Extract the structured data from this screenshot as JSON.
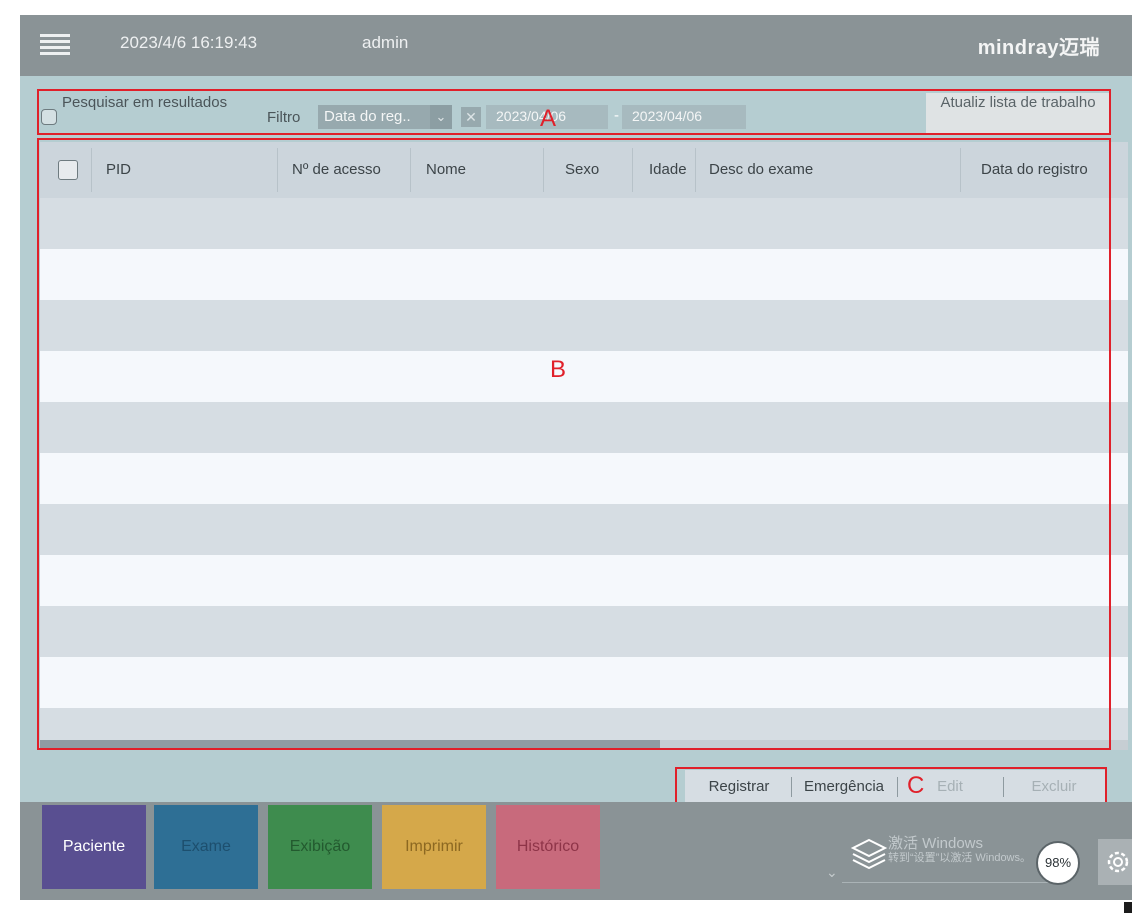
{
  "header": {
    "datetime": "2023/4/6 16:19:43",
    "user": "admin",
    "brand": "mindray迈瑞"
  },
  "filters": {
    "search_in_results_label": "Pesquisar em resultados",
    "filter_label": "Filtro",
    "filter_field": "Data do reg..",
    "date_from": "2023/04/06",
    "date_separator": "-",
    "date_to": "2023/04/06",
    "refresh_label": "Atualiz lista de trabalho"
  },
  "table": {
    "columns": [
      "PID",
      "Nº de acesso",
      "Nome",
      "Sexo",
      "Idade",
      "Desc do exame",
      "Data do registro"
    ],
    "rows": []
  },
  "actions": [
    {
      "label": "Registrar",
      "enabled": true
    },
    {
      "label": "Emergência",
      "enabled": true
    },
    {
      "label": "Edit",
      "enabled": false
    },
    {
      "label": "Excluir",
      "enabled": false
    }
  ],
  "nav": {
    "paciente": "Paciente",
    "exame": "Exame",
    "exibicao": "Exibição",
    "imprimir": "Imprimir",
    "historico": "Histórico"
  },
  "status": {
    "battery": "98%",
    "watermark_title": "激活 Windows",
    "watermark_sub": "转到“设置”以激活 Windows。"
  },
  "annotations": {
    "a": "A",
    "b": "B",
    "c": "C"
  },
  "colors": {
    "topbar": "#8a9396",
    "main_bg": "#b5cdd1",
    "annotation_red": "#e0202a",
    "tab_paciente": "#594f91",
    "tab_exame": "#2e6f95",
    "tab_exibicao": "#3e8c4e",
    "tab_imprimir": "#d5a84a",
    "tab_historico": "#c86a7c"
  },
  "icons": {
    "menu": "hamburger-menu-icon",
    "clear": "close-icon",
    "dropdown": "chevron-down-icon",
    "layers": "layers-icon",
    "settings": "gear-icon"
  }
}
